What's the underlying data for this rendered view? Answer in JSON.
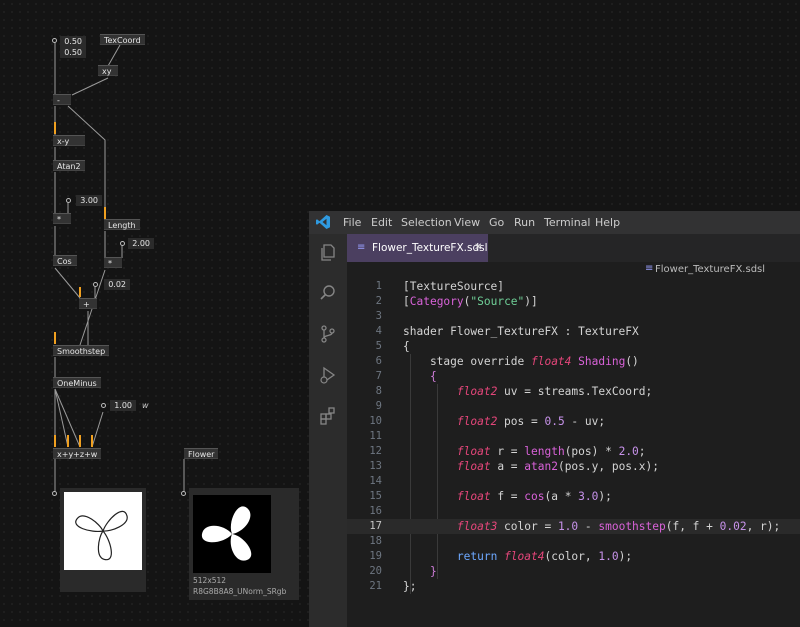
{
  "patch": {
    "nodes": {
      "texcoord": "TexCoord",
      "xy": "xy",
      "subtract": "-",
      "x_minus_y": "x-y",
      "atan2": "Atan2",
      "multiply": "*",
      "length": "Length",
      "cos": "Cos",
      "multiply2": "*",
      "add": "+",
      "smoothstep": "Smoothstep",
      "oneminus": "OneMinus",
      "join": "x+y+z+w",
      "flower": "Flower"
    },
    "values": {
      "v1": "0.50",
      "v2": "0.50",
      "v3": "3.00",
      "v4": "2.00",
      "v5": "0.02",
      "v6": "1.00"
    },
    "w_label": "w",
    "preview2_size": "512x512",
    "preview2_format": "R8G8B8A8_UNorm_SRgb"
  },
  "vscode": {
    "menu": [
      "File",
      "Edit",
      "Selection",
      "View",
      "Go",
      "Run",
      "Terminal",
      "Help"
    ],
    "tab_label": "Flower_TextureFX.sdsl",
    "tab_close": "✕",
    "breadcrumb": "Flower_TextureFX.sdsl",
    "icons": [
      "explorer-icon",
      "search-icon",
      "source-control-icon",
      "run-debug-icon",
      "extensions-icon"
    ],
    "current_line": 17,
    "lines": [
      [
        [
          "[TextureSource]",
          "t-punc"
        ]
      ],
      [
        [
          "[",
          "t-punc"
        ],
        [
          "Category",
          "t-fn"
        ],
        [
          "(",
          "t-punc"
        ],
        [
          "\"Source\"",
          "t-str"
        ],
        [
          ")]",
          "t-punc"
        ]
      ],
      [],
      [
        [
          "shader Flower_TextureFX : TextureFX",
          "t-punc"
        ]
      ],
      [
        [
          "{",
          "t-punc"
        ]
      ],
      [
        [
          "    stage override ",
          "t-punc"
        ],
        [
          "float4",
          "t-type"
        ],
        [
          " ",
          "t-punc"
        ],
        [
          "Shading",
          "t-fn"
        ],
        [
          "()",
          "t-punc"
        ]
      ],
      [
        [
          "    ",
          "t-punc"
        ],
        [
          "{",
          "t-brace"
        ]
      ],
      [
        [
          "        ",
          "t-punc"
        ],
        [
          "float2",
          "t-type"
        ],
        [
          " uv = streams.TexCoord;",
          "t-punc"
        ]
      ],
      [],
      [
        [
          "        ",
          "t-punc"
        ],
        [
          "float2",
          "t-type"
        ],
        [
          " pos = ",
          "t-punc"
        ],
        [
          "0.5",
          "t-num"
        ],
        [
          " - uv;",
          "t-punc"
        ]
      ],
      [],
      [
        [
          "        ",
          "t-punc"
        ],
        [
          "float",
          "t-type"
        ],
        [
          " r = ",
          "t-punc"
        ],
        [
          "length",
          "t-fn"
        ],
        [
          "(pos) * ",
          "t-punc"
        ],
        [
          "2.0",
          "t-num"
        ],
        [
          ";",
          "t-punc"
        ]
      ],
      [
        [
          "        ",
          "t-punc"
        ],
        [
          "float",
          "t-type"
        ],
        [
          " a = ",
          "t-punc"
        ],
        [
          "atan2",
          "t-fn"
        ],
        [
          "(pos.y, pos.x);",
          "t-punc"
        ]
      ],
      [],
      [
        [
          "        ",
          "t-punc"
        ],
        [
          "float",
          "t-type"
        ],
        [
          " f = ",
          "t-punc"
        ],
        [
          "cos",
          "t-fn"
        ],
        [
          "(a * ",
          "t-punc"
        ],
        [
          "3.0",
          "t-num"
        ],
        [
          ");",
          "t-punc"
        ]
      ],
      [],
      [
        [
          "        ",
          "t-punc"
        ],
        [
          "float3",
          "t-type"
        ],
        [
          " color = ",
          "t-punc"
        ],
        [
          "1.0",
          "t-num"
        ],
        [
          " - ",
          "t-punc"
        ],
        [
          "smoothstep",
          "t-fn"
        ],
        [
          "(f, f + ",
          "t-punc"
        ],
        [
          "0.02",
          "t-num"
        ],
        [
          ", r);",
          "t-punc"
        ]
      ],
      [],
      [
        [
          "        ",
          "t-punc"
        ],
        [
          "return",
          "t-kw"
        ],
        [
          " ",
          "t-punc"
        ],
        [
          "float4",
          "t-type"
        ],
        [
          "(color, ",
          "t-punc"
        ],
        [
          "1.0",
          "t-num"
        ],
        [
          ");",
          "t-punc"
        ]
      ],
      [
        [
          "    ",
          "t-punc"
        ],
        [
          "}",
          "t-brace"
        ]
      ],
      [
        [
          "};",
          "t-punc"
        ]
      ]
    ],
    "colors": {
      "accent_tab": "#4b3f60",
      "type": "#e4467a",
      "function": "#d862d8",
      "keyword": "#6da8ff",
      "string": "#6fcf97",
      "number": "#c792ea"
    }
  }
}
